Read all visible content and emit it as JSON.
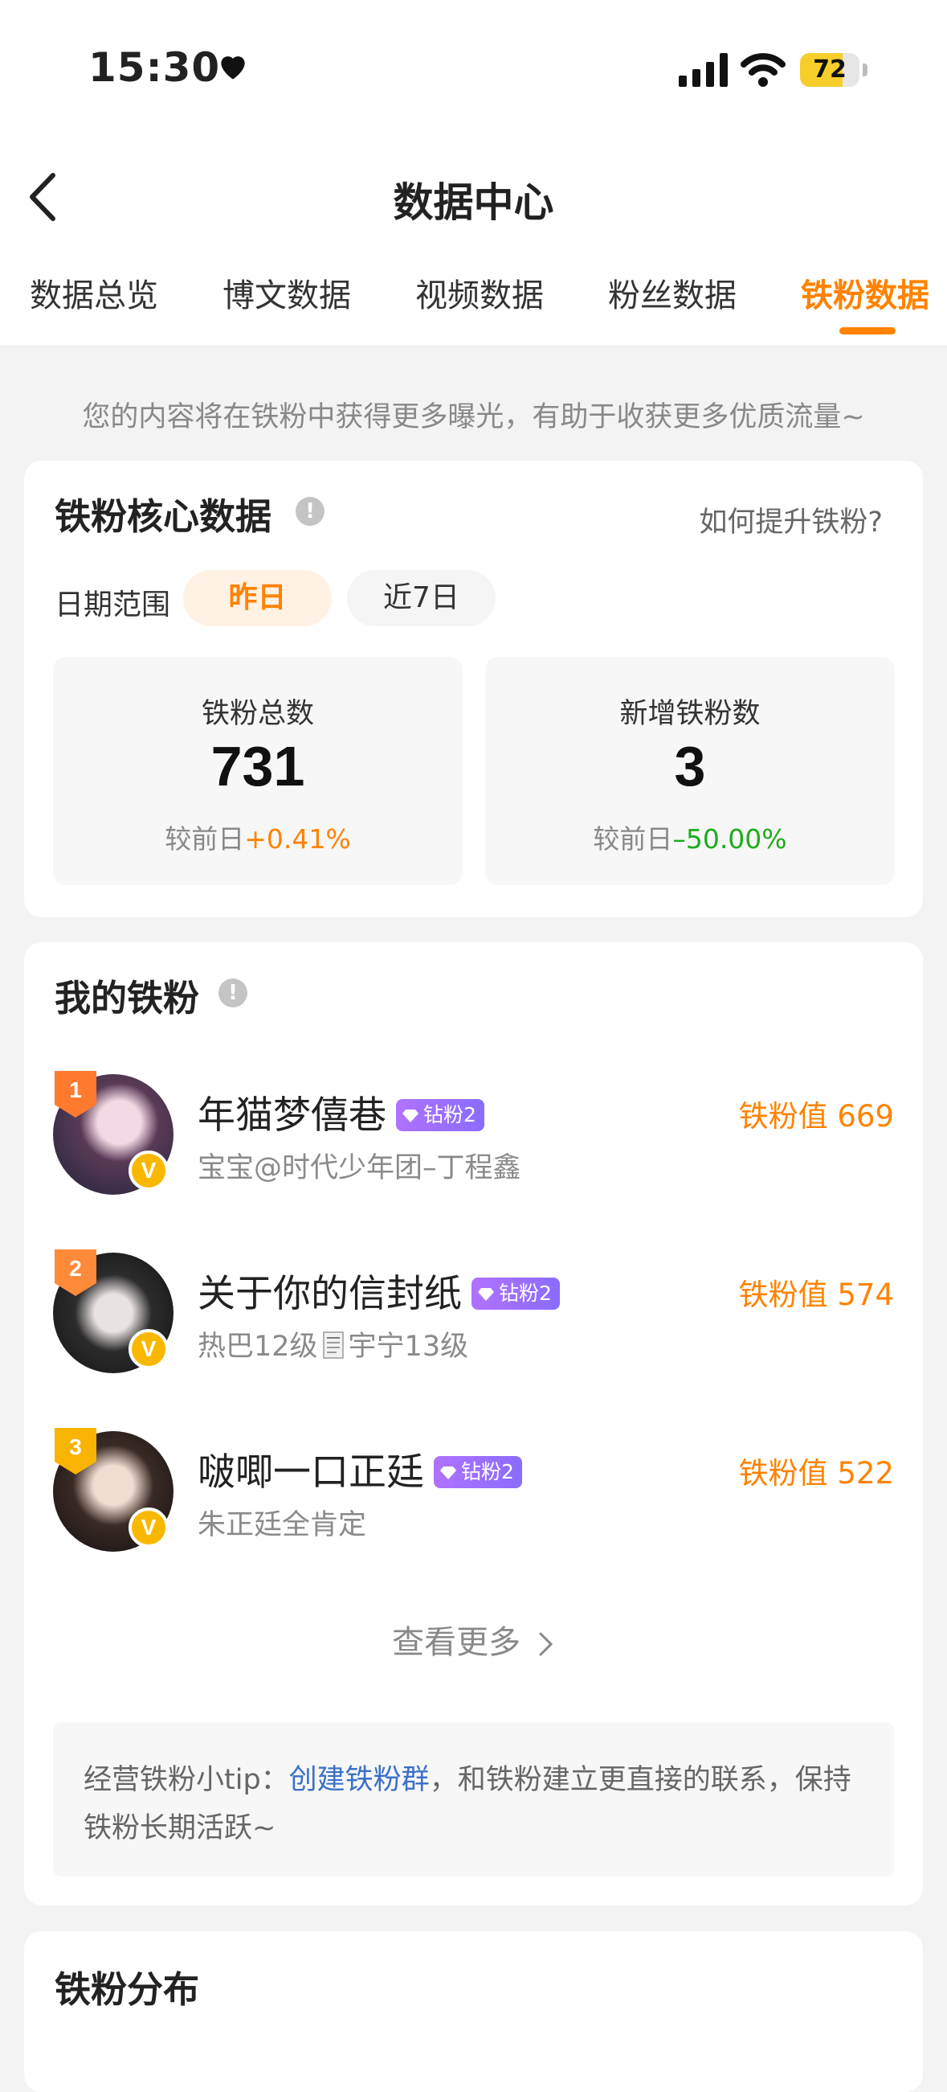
{
  "status_bar": {
    "time": "15:30",
    "battery_level": "72",
    "battery_fraction": 0.72
  },
  "nav": {
    "title": "数据中心"
  },
  "tabs": [
    {
      "label": "数据总览",
      "active": false
    },
    {
      "label": "博文数据",
      "active": false
    },
    {
      "label": "视频数据",
      "active": false
    },
    {
      "label": "粉丝数据",
      "active": false
    },
    {
      "label": "铁粉数据",
      "active": true
    }
  ],
  "notice": "您的内容将在铁粉中获得更多曝光，有助于收获更多优质流量~",
  "core_card": {
    "title": "铁粉核心数据",
    "help_link": "如何提升铁粉?",
    "date_label": "日期范围",
    "date_options": [
      "昨日",
      "近7日"
    ],
    "stats": [
      {
        "label": "铁粉总数",
        "value": "731",
        "compare_prefix": "较前日",
        "change": "+0.41%"
      },
      {
        "label": "新增铁粉数",
        "value": "3",
        "compare_prefix": "较前日",
        "change": "–50.00%"
      }
    ]
  },
  "my_fans": {
    "title": "我的铁粉",
    "items": [
      {
        "rank": "1",
        "name": "年猫梦僖巷",
        "badge": "钻粉2",
        "subtitle": "宝宝@时代少年团–丁程鑫",
        "score": "铁粉值 669"
      },
      {
        "rank": "2",
        "name": "关于你的信封纸",
        "badge": "钻粉2",
        "subtitle_a": "热巴12级",
        "subtitle_b": "宇宁13级",
        "score": "铁粉值 574"
      },
      {
        "rank": "3",
        "name": "啵唧一口正廷",
        "badge": "钻粉2",
        "subtitle": "朱正廷全肯定",
        "score": "铁粉值 522"
      }
    ],
    "more": "查看更多",
    "tip_prefix": "经营铁粉小tip：",
    "tip_link": "创建铁粉群",
    "tip_suffix": "，和铁粉建立更直接的联系，保持铁粉长期活跃~"
  },
  "distribution": {
    "title": "铁粉分布"
  },
  "colors": {
    "accent": "#ff8200",
    "positive": "#ff8200",
    "negative": "#1aad19",
    "link": "#3b70c8",
    "badge": "#9a6cff"
  }
}
